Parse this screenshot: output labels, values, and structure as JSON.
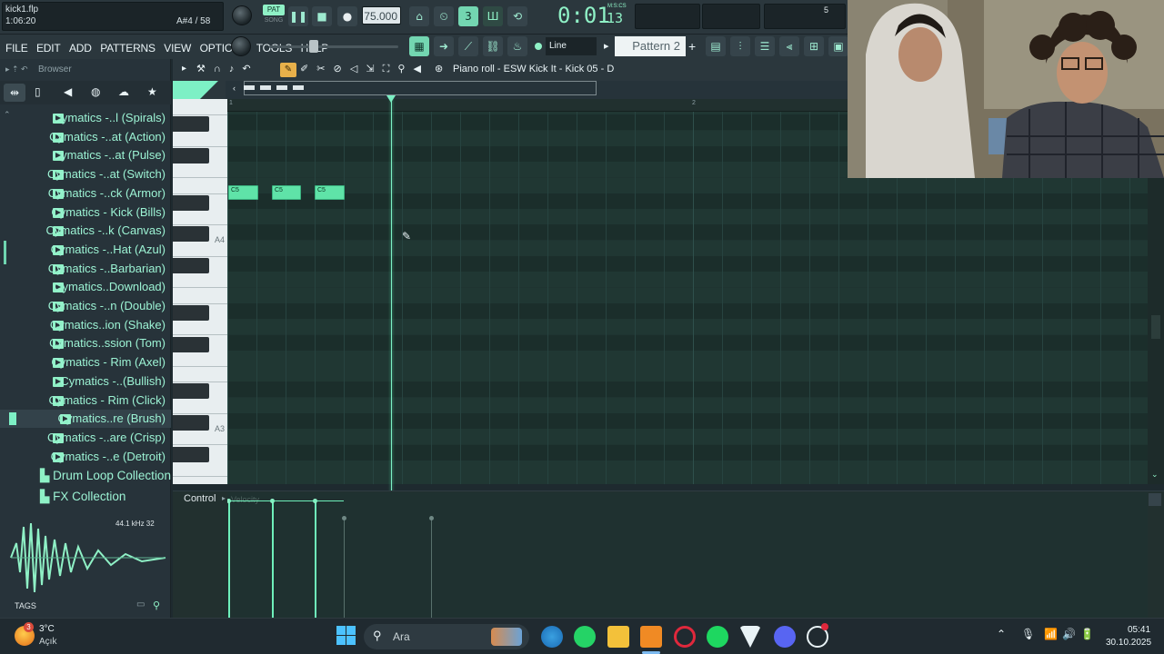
{
  "project": {
    "filename": "kick1.flp",
    "time": "1:06:20",
    "note_readout": "A#4 / 58"
  },
  "transport": {
    "mode_pat": "PAT",
    "mode_song": "SONG",
    "tempo": "75.000",
    "clock_main": "0:01",
    "clock_sub": "13",
    "clock_unit": "M:S:CS",
    "cpu": "5",
    "snap_mode": "Line",
    "pattern": "Pattern 2"
  },
  "menu": [
    "FILE",
    "EDIT",
    "ADD",
    "PATTERNS",
    "VIEW",
    "OPTIONS",
    "TOOLS",
    "HELP"
  ],
  "browser": {
    "title": "Browser",
    "items": [
      "Cymatics -..l (Spirals)",
      "Cymatics -..at (Action)",
      "Cymatics -..at (Pulse)",
      "Cymatics -..at (Switch)",
      "Cymatics -..ck (Armor)",
      "Cymatics - Kick (Bills)",
      "Cymatics -..k (Canvas)",
      "Cymatics -..Hat (Azul)",
      "Cymatics -..Barbarian)",
      "Cymatics..Download)",
      "Cymatics -..n (Double)",
      "Cymatics..ion (Shake)",
      "Cymatics..ssion (Tom)",
      "Cymatics - Rim (Axel)",
      "Cymatics -..(Bullish)",
      "Cymatics - Rim (Click)",
      "Cymatics..re (Brush)",
      "Cymatics -..are (Crisp)",
      "Cymatics -..e (Detroit)"
    ],
    "selected_index": 16,
    "folders": [
      "Drum Loop Collection",
      "FX Collection"
    ],
    "sample_info": "44.1 kHz 32",
    "tags_label": "TAGS"
  },
  "piano_roll": {
    "title": "Piano roll - ESW Kick It - Kick 05 - D",
    "key_labels": [
      "A4",
      "A3"
    ],
    "ruler": [
      "1",
      "2"
    ],
    "note_label": "C5",
    "control_label": "Control",
    "control_hint": "Velocity"
  },
  "taskbar": {
    "weather_temp": "3°C",
    "weather_desc": "Açık",
    "weather_badge": "3",
    "search_label": "Ara",
    "clock_time": "05:41",
    "clock_date": "30.10.2025"
  }
}
